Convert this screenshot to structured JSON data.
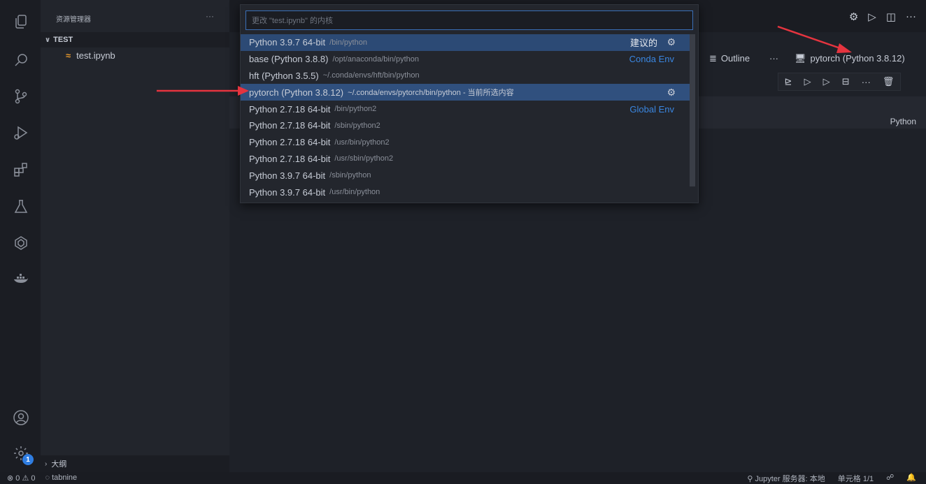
{
  "sidebar": {
    "title": "资源管理器",
    "more": "···",
    "section": "TEST",
    "file": "test.ipynb",
    "outline_section": "大纲"
  },
  "activity": {
    "icons": [
      "files-icon",
      "search-icon",
      "source-control-icon",
      "run-debug-icon",
      "extensions-icon",
      "testing-icon",
      "remote-icon",
      "docker-icon",
      "account-icon",
      "settings-icon"
    ],
    "settings_badge": "1"
  },
  "editor": {
    "outline": "Outline",
    "more": "···",
    "kernel": "pytorch (Python 3.8.12)",
    "language": "Python",
    "top_more": "···"
  },
  "quick_pick": {
    "placeholder": "更改 \"test.ipynb\" 的内核",
    "items": [
      {
        "label": "Python 3.9.7 64-bit",
        "desc": "/bin/python",
        "tag": "建议的"
      },
      {
        "label": "base (Python 3.8.8)",
        "desc": "/opt/anaconda/bin/python",
        "tag": "Conda Env"
      },
      {
        "label": "hft (Python 3.5.5)",
        "desc": "~/.conda/envs/hft/bin/python",
        "tag": ""
      },
      {
        "label": "pytorch (Python 3.8.12)",
        "desc": "~/.conda/envs/pytorch/bin/python - 当前所选内容",
        "tag": ""
      },
      {
        "label": "Python 2.7.18 64-bit",
        "desc": "/bin/python2",
        "tag": "Global Env"
      },
      {
        "label": "Python 2.7.18 64-bit",
        "desc": "/sbin/python2",
        "tag": ""
      },
      {
        "label": "Python 2.7.18 64-bit",
        "desc": "/usr/bin/python2",
        "tag": ""
      },
      {
        "label": "Python 2.7.18 64-bit",
        "desc": "/usr/sbin/python2",
        "tag": ""
      },
      {
        "label": "Python 3.9.7 64-bit",
        "desc": "/sbin/python",
        "tag": ""
      },
      {
        "label": "Python 3.9.7 64-bit",
        "desc": "/usr/bin/python",
        "tag": ""
      }
    ]
  },
  "status": {
    "problems": "⊗ 0 ⚠ 0",
    "tabnine": "tabnine",
    "jupyter": "Jupyter 服务器: 本地",
    "cell": "单元格 1/1"
  },
  "colors": {
    "accent": "#3a86e0",
    "selection": "#2c4a75",
    "arrow": "#e5343f"
  }
}
